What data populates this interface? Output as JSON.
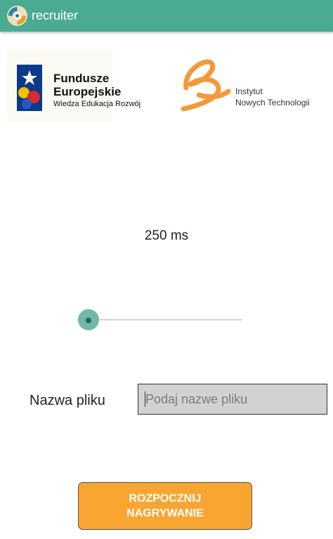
{
  "app_bar": {
    "title": "recruiter",
    "icon": "app-logo-icon",
    "background_color": "#4aaa94"
  },
  "logos": {
    "fundusze": {
      "line1": "Fundusze",
      "line2": "Europejskie",
      "line3": "Wiedza Edukacja Rozwój"
    },
    "instytut": {
      "line1": "Instytut",
      "line2": "Nowych Technologii",
      "accent_color": "#f29a3a"
    }
  },
  "delay": {
    "value_label": "250 ms",
    "slider_value": 0.0
  },
  "filename": {
    "label": "Nazwa pliku",
    "value": "",
    "placeholder": "Podaj nazwe pliku"
  },
  "record_button": {
    "line1": "ROZPOCZNIJ",
    "line2": "NAGRYWANIE",
    "color": "#f8a532"
  }
}
